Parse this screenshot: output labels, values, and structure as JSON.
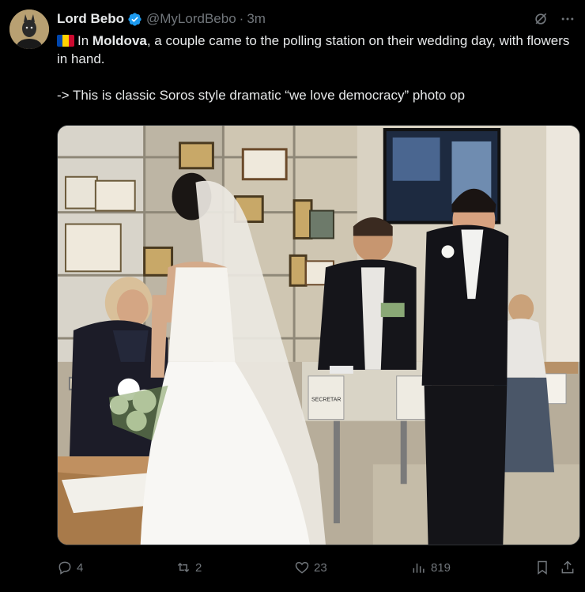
{
  "author": {
    "name": "Lord Bebo",
    "handle": "@MyLordBebo",
    "separator": "·",
    "time": "3m"
  },
  "tweet": {
    "line1_prefix": "In ",
    "line1_bold": "Moldova",
    "line1_rest": ", a couple came to the polling station on their wedding day, with flowers in hand.",
    "line2": "-> This is classic Soros style dramatic “we love democracy” photo op",
    "flag_colors": [
      "#0046ae",
      "#ffd200",
      "#cc092f"
    ]
  },
  "media": {
    "sign_text": "SECRETAR"
  },
  "stats": {
    "replies": "4",
    "reposts": "2",
    "likes": "23",
    "views": "819"
  },
  "colors": {
    "background": "#000000",
    "text": "#e7e9ea",
    "muted": "#71767b",
    "verified": "#1d9bf0"
  }
}
